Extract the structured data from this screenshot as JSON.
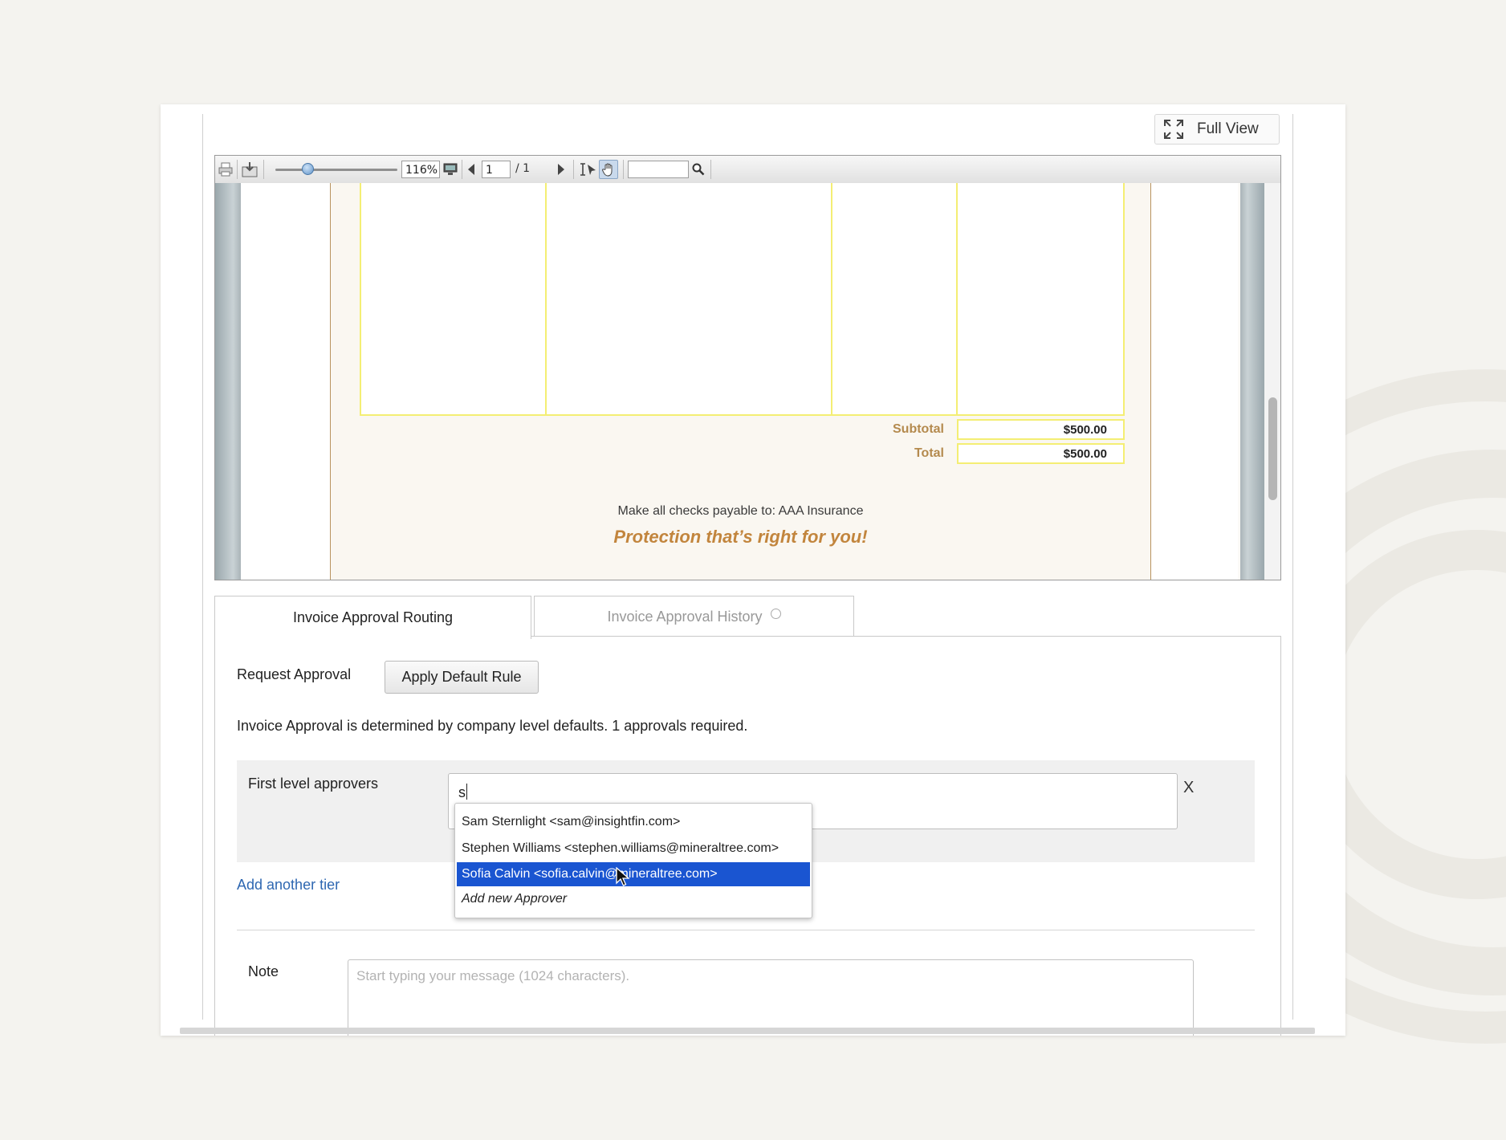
{
  "header": {
    "full_view_label": "Full View"
  },
  "viewer_toolbar": {
    "zoom": "116%",
    "page_current": "1",
    "page_total": "/ 1",
    "search_value": ""
  },
  "document": {
    "subtotal_label": "Subtotal",
    "subtotal_value": "$500.00",
    "total_label": "Total",
    "total_value": "$500.00",
    "payable_text": "Make all checks payable to:  AAA Insurance",
    "slogan": "Protection that’s right for you!"
  },
  "tabs": [
    {
      "label": "Invoice Approval Routing",
      "active": true
    },
    {
      "label": "Invoice Approval History",
      "active": false
    }
  ],
  "routing": {
    "request_label": "Request Approval",
    "apply_default_label": "Apply Default Rule",
    "info_text": "Invoice Approval is determined by company level defaults. 1 approvals required.",
    "first_level_label": "First level approvers",
    "approver_input_value": "s",
    "remove_label": "X",
    "add_tier_label": "Add another tier",
    "note_label": "Note",
    "note_placeholder": "Start typing your message (1024 characters)."
  },
  "dropdown": {
    "items": [
      {
        "label": "Sam Sternlight <sam@insightfin.com>",
        "selected": false
      },
      {
        "label": "Stephen Williams <stephen.williams@mineraltree.com>",
        "selected": false
      },
      {
        "label": "Sofia Calvin <sofia.calvin@mineraltree.com>",
        "selected": true
      },
      {
        "label": "Add new Approver",
        "selected": false
      }
    ]
  },
  "colors": {
    "accent": "#1a55d1",
    "link": "#2e67b1",
    "doc_gold": "#c2853d",
    "table_border": "#f4ee73"
  },
  "icons": [
    "expand-icon",
    "print-icon",
    "save-icon",
    "monitor-icon",
    "prev-page-icon",
    "next-page-icon",
    "text-select-icon",
    "hand-icon",
    "search-icon"
  ]
}
